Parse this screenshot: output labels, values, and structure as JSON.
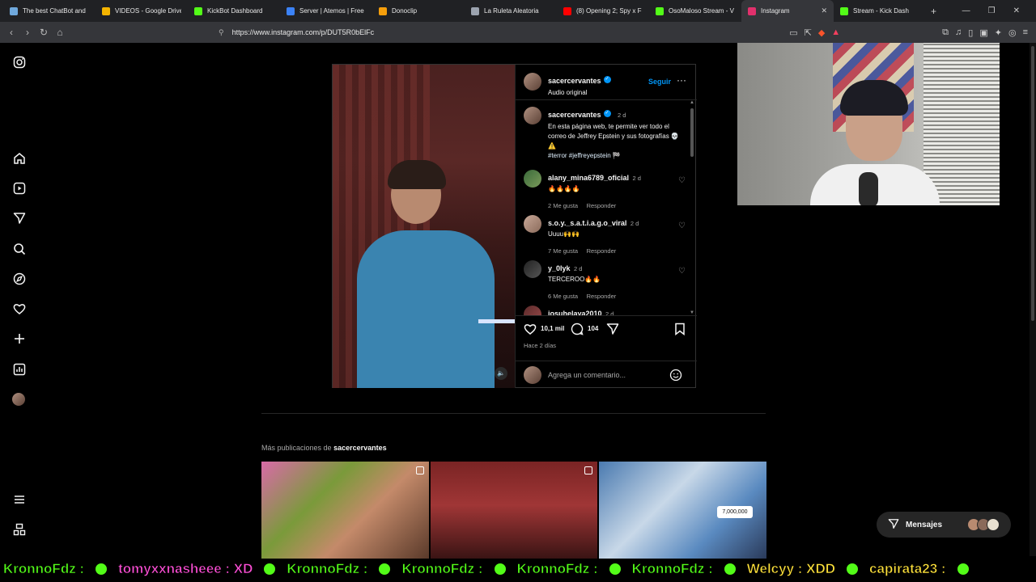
{
  "browser": {
    "tabs": [
      {
        "label": "The best ChatBot and",
        "color": "#6fa8dc"
      },
      {
        "label": "VIDEOS - Google Drive",
        "color": "#f4b400"
      },
      {
        "label": "KickBot Dashboard",
        "color": "#53fc18"
      },
      {
        "label": "Server | Atemos | Free",
        "color": "#3b82f6"
      },
      {
        "label": "Donoclip",
        "color": "#f59e0b"
      },
      {
        "label": "La Ruleta Aleatoria",
        "color": "#9ca3af"
      },
      {
        "label": "(8) Opening 2; Spy x F",
        "color": "#ff0000"
      },
      {
        "label": "OsoMaloso Stream - V",
        "color": "#53fc18"
      },
      {
        "label": "Instagram",
        "color": "#e1306c"
      },
      {
        "label": "Stream - Kick Dash",
        "color": "#53fc18"
      }
    ],
    "url": "https://www.instagram.com/p/DUT5R0bElFc"
  },
  "sidebar": {
    "icons": [
      "instagram-icon",
      "home-icon",
      "reels-icon",
      "send-icon",
      "search-icon",
      "explore-icon",
      "heart-icon",
      "create-icon",
      "dashboard-icon",
      "profile-icon",
      "menu-icon",
      "threads-icon"
    ]
  },
  "post": {
    "author": "sacercervantes",
    "audio": "Audio original",
    "follow": "Seguir",
    "caption": {
      "user": "sacercervantes",
      "time": "2 d",
      "text": "En esta página web, te permite ver todo el correo de Jeffrey Epstein y sus fotografías 💀 ⚠️",
      "tags": "#terror #jeffreyepstein 🏁"
    },
    "comments": [
      {
        "user": "alany_mina6789_oficial",
        "time": "2 d",
        "text": "🔥🔥🔥🔥",
        "likes": "2 Me gusta",
        "reply": "Responder"
      },
      {
        "user": "s.o.y._s.a.t.i.a.g.o_viral",
        "time": "2 d",
        "text": "Uuuu🙌🙌",
        "likes": "7 Me gusta",
        "reply": "Responder"
      },
      {
        "user": "y_0lyk",
        "time": "2 d",
        "text": "TERCEROO🔥🔥",
        "likes": "6 Me gusta",
        "reply": "Responder"
      },
      {
        "user": "josuhelaya2010",
        "time": "2 d",
        "text": "",
        "likes": "",
        "reply": ""
      }
    ],
    "like_count": "10,1 mil",
    "comment_count": "104",
    "posted": "Hace 2 días",
    "add_comment_placeholder": "Agrega un comentario..."
  },
  "more": {
    "label": "Más publicaciones de",
    "user": "sacercervantes",
    "thumb3_text": "7,000,000"
  },
  "messages": {
    "label": "Mensajes"
  },
  "ticker": [
    {
      "text": "KronnoFdz :",
      "color": "green"
    },
    {
      "text": "tomyxxnasheee : XD",
      "color": "pink"
    },
    {
      "text": "KronnoFdz :",
      "color": "green"
    },
    {
      "text": "KronnoFdz :",
      "color": "green"
    },
    {
      "text": "KronnoFdz :",
      "color": "green"
    },
    {
      "text": "KronnoFdz :",
      "color": "green"
    },
    {
      "text": "Welcyy : XDD",
      "color": "yellow"
    },
    {
      "text": "capirata23 :",
      "color": "yellow"
    }
  ]
}
